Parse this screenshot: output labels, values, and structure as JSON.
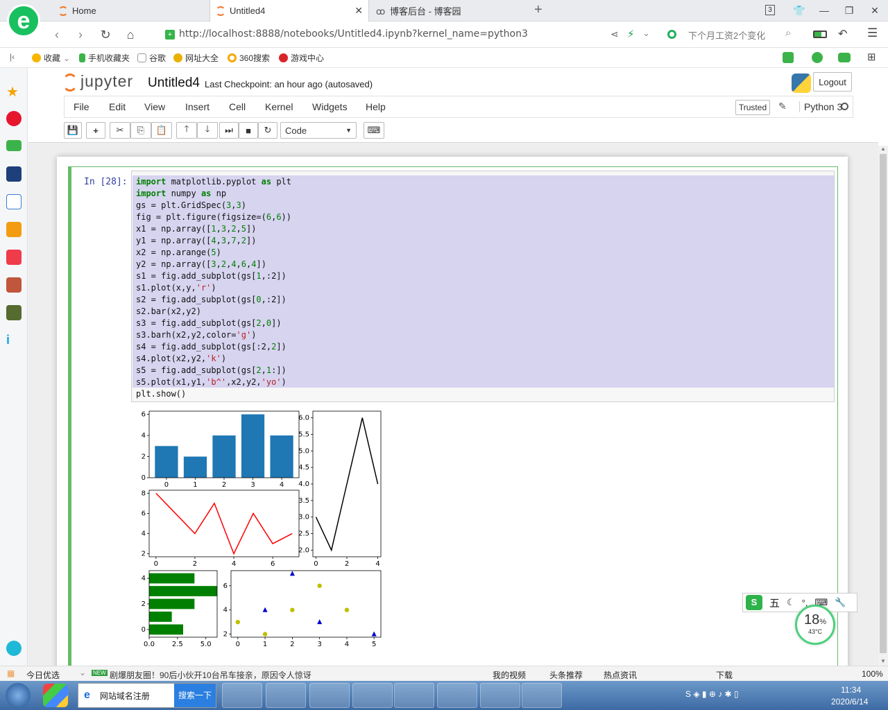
{
  "browser": {
    "tabs": [
      {
        "label": "Home"
      },
      {
        "label": "Untitled4"
      },
      {
        "label": "博客后台 - 博客园"
      }
    ],
    "tab_count": "3",
    "url": "http://localhost:8888/notebooks/Untitled4.ipynb?kernel_name=python3",
    "search_placeholder": "下个月工资2个变化",
    "favorites": [
      "收藏",
      "手机收藏夹",
      "谷歌",
      "网址大全",
      "360搜索",
      "游戏中心"
    ]
  },
  "jupyter": {
    "logo": "jupyter",
    "notebook_name": "Untitled4",
    "checkpoint": "Last Checkpoint: an hour ago (autosaved)",
    "logout": "Logout",
    "menu": [
      "File",
      "Edit",
      "View",
      "Insert",
      "Cell",
      "Kernel",
      "Widgets",
      "Help"
    ],
    "trusted": "Trusted",
    "kernel": "Python 3",
    "cell_type": "Code",
    "prompt": "In  [28]:"
  },
  "code_lines": [
    "import matplotlib.pyplot as plt",
    "import numpy as np",
    "gs = plt.GridSpec(3,3)",
    "fig = plt.figure(figsize=(6,6))",
    "x1 = np.array([1,3,2,5])",
    "y1 = np.array([4,3,7,2])",
    "x2 = np.arange(5)",
    "y2 = np.array([3,2,4,6,4])",
    "s1 = fig.add_subplot(gs[1,:2])",
    "s1.plot(x,y,'r')",
    "s2 = fig.add_subplot(gs[0,:2])",
    "s2.bar(x2,y2)",
    "s3 = fig.add_subplot(gs[2,0])",
    "s3.barh(x2,y2,color='g')",
    "s4 = fig.add_subplot(gs[:2,2])",
    "s4.plot(x2,y2,'k')",
    "s5 = fig.add_subplot(gs[2,1:])",
    "s5.plot(x1,y1,'b^',x2,y2,'yo')",
    "plt.show()"
  ],
  "chart_data": [
    {
      "type": "bar",
      "id": "s2",
      "categories": [
        "0",
        "1",
        "2",
        "3",
        "4"
      ],
      "values": [
        3,
        2,
        4,
        6,
        4
      ],
      "ylim": [
        0,
        6
      ],
      "yticks": [
        "0",
        "2",
        "4",
        "6"
      ],
      "color": "#1f77b4"
    },
    {
      "type": "line",
      "id": "s1",
      "x": [
        0,
        1,
        2,
        3,
        4,
        5,
        6,
        7
      ],
      "y": [
        8,
        6,
        4,
        7,
        2,
        6,
        3,
        4
      ],
      "xticks": [
        "0",
        "2",
        "4",
        "6"
      ],
      "yticks": [
        "2",
        "4",
        "6",
        "8"
      ],
      "xlim": [
        -0.35,
        7.35
      ],
      "ylim": [
        1.7,
        8.3
      ],
      "color": "#ff0000"
    },
    {
      "type": "bar",
      "id": "s3",
      "orientation": "horizontal",
      "categories": [
        0,
        1,
        2,
        3,
        4
      ],
      "values": [
        3,
        2,
        4,
        6,
        4
      ],
      "xticks": [
        "0.0",
        "2.5",
        "5.0"
      ],
      "yticks": [
        "0",
        "2",
        "4"
      ],
      "xlim": [
        0,
        6
      ],
      "color": "#008000"
    },
    {
      "type": "line",
      "id": "s4",
      "x": [
        0,
        1,
        2,
        3,
        4
      ],
      "y": [
        3,
        2,
        4,
        6,
        4
      ],
      "xticks": [
        "0",
        "2",
        "4"
      ],
      "yticks": [
        "2.0",
        "2.5",
        "3.0",
        "3.5",
        "4.0",
        "4.5",
        "5.0",
        "5.5",
        "6.0"
      ],
      "xlim": [
        -0.2,
        4.2
      ],
      "ylim": [
        1.8,
        6.2
      ],
      "color": "#000000"
    },
    {
      "type": "scatter",
      "id": "s5",
      "series": [
        {
          "x": [
            1,
            3,
            2,
            5
          ],
          "y": [
            4,
            3,
            7,
            2
          ],
          "marker": "triangle",
          "color": "#0000cc"
        },
        {
          "x": [
            0,
            1,
            2,
            3,
            4
          ],
          "y": [
            3,
            2,
            4,
            6,
            4
          ],
          "marker": "circle",
          "color": "#bfbf00"
        }
      ],
      "xticks": [
        "0",
        "1",
        "2",
        "3",
        "4",
        "5"
      ],
      "yticks": [
        "2",
        "4",
        "6"
      ],
      "xlim": [
        -0.25,
        5.25
      ],
      "ylim": [
        1.75,
        7.25
      ]
    }
  ],
  "statusbar": {
    "left": "今日优选",
    "news_badge": "NEW",
    "news": "剧爆朋友圈！90后小伙开10台吊车接亲，原因令人惊讶",
    "items": [
      "我的视频",
      "头条推荐",
      "热点资讯",
      "下载"
    ],
    "zoom": "100%"
  },
  "widget": {
    "ime": "五",
    "percent": "18",
    "percent_unit": "%",
    "temp": "43°C"
  },
  "taskbar": {
    "app_label": "网站域名注册",
    "search_btn": "搜索一下",
    "time": "11:34",
    "date": "2020/6/14"
  }
}
